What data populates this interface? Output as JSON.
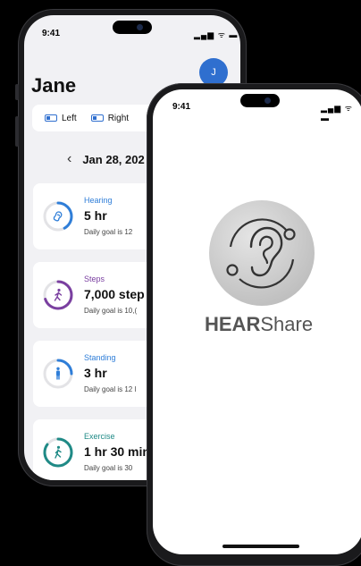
{
  "back_phone": {
    "status_time": "9:41",
    "status_icons": "▂▄▆ ᯤ ▬",
    "user_name": "Jane",
    "avatar_initial": "J",
    "hearing_aids": {
      "left_label": "Left",
      "right_label": "Right"
    },
    "date": "Jan 28, 202",
    "cards": [
      {
        "label": "Hearing",
        "value": "5 hr",
        "goal": "Daily goal is 12",
        "color": "#2f7ed8",
        "progress": 0.42,
        "icon": "ear-icon"
      },
      {
        "label": "Steps",
        "value": "7,000 step",
        "goal": "Daily goal is 10,(",
        "color": "#7a3fa0",
        "progress": 0.7,
        "icon": "walking-person-icon"
      },
      {
        "label": "Standing",
        "value": "3 hr",
        "goal": "Daily goal is 12 l",
        "color": "#2f7ed8",
        "progress": 0.25,
        "icon": "standing-person-icon"
      },
      {
        "label": "Exercise",
        "value": "1 hr 30 min",
        "goal": "Daily goal is 30",
        "color": "#1f8a86",
        "progress": 0.85,
        "icon": "exercise-person-icon"
      }
    ]
  },
  "front_phone": {
    "status_time": "9:41",
    "status_icons": "▂▄▆ ᯤ ▬",
    "logo_bold": "HEAR",
    "logo_light": "Share"
  }
}
